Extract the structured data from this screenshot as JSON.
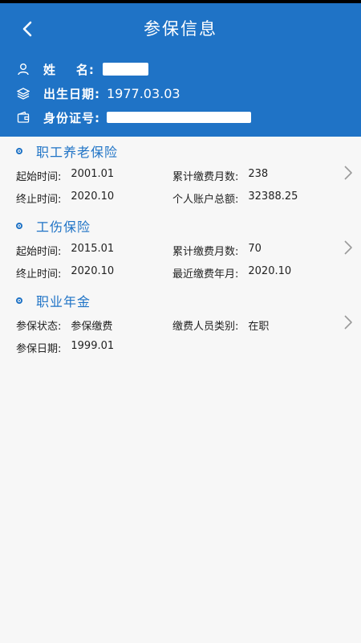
{
  "header": {
    "title": "参保信息",
    "name_label": "姓    名:",
    "birth_label": "出生日期:",
    "birth_value": "1977.03.03",
    "id_label": "身份证号:"
  },
  "sections": [
    {
      "title": "职工养老保险",
      "fields": [
        {
          "label": "起始时间:",
          "value": "2001.01"
        },
        {
          "label": "累计缴费月数:",
          "value": "238"
        },
        {
          "label": "终止时间:",
          "value": "2020.10"
        },
        {
          "label": "个人账户总额:",
          "value": "32388.25"
        }
      ]
    },
    {
      "title": "工伤保险",
      "fields": [
        {
          "label": "起始时间:",
          "value": "2015.01"
        },
        {
          "label": "累计缴费月数:",
          "value": "70"
        },
        {
          "label": "终止时间:",
          "value": "2020.10"
        },
        {
          "label": "最近缴费年月:",
          "value": "2020.10"
        }
      ]
    },
    {
      "title": "职业年金",
      "fields": [
        {
          "label": "参保状态:",
          "value": "参保缴费"
        },
        {
          "label": "缴费人员类别:",
          "value": "在职"
        },
        {
          "label": "参保日期:",
          "value": "1999.01"
        }
      ]
    }
  ],
  "icons": {
    "back": "chevron-left-icon",
    "name": "person-icon",
    "birth": "layers-icon",
    "id": "wallet-icon",
    "section": "bullet-circle-icon",
    "detail": "chevron-right-icon"
  },
  "colors": {
    "primary": "#1f73c6",
    "background": "#f7f7f7"
  }
}
